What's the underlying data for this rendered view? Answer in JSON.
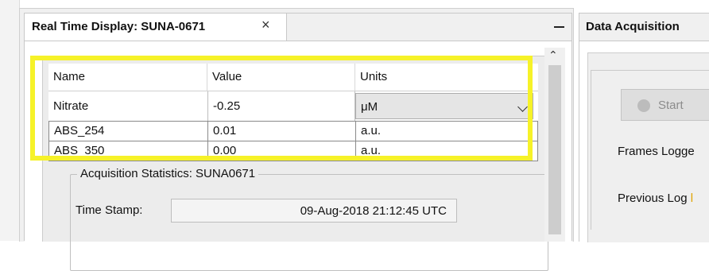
{
  "left_panel": {
    "tab_title": "Real Time Display: SUNA-0671",
    "tab_close": "×"
  },
  "table": {
    "headers": [
      "Name",
      "Value",
      "Units"
    ],
    "rows": [
      {
        "name": "Nitrate",
        "value": "-0.25",
        "units": "μM"
      },
      {
        "name": "ABS_254",
        "value": "0.01",
        "units": "a.u."
      },
      {
        "name": "ABS_350",
        "value": "0.00",
        "units": "a.u."
      }
    ]
  },
  "acquisition_statistics": {
    "title": "Acquisition Statistics: SUNA0671",
    "time_stamp_label": "Time Stamp:",
    "time_stamp_value": "09-Aug-2018 21:12:45 UTC"
  },
  "right_panel": {
    "title": "Data Acquisition",
    "start_button": "Start",
    "frames_logged_label": "Frames Logge",
    "previous_log_label": "Previous Log",
    "previous_log_tail": "l"
  },
  "colors": {
    "highlight": "#f6f228",
    "panel_bg": "#f0f0f0",
    "link_accent": "#e0a400"
  }
}
